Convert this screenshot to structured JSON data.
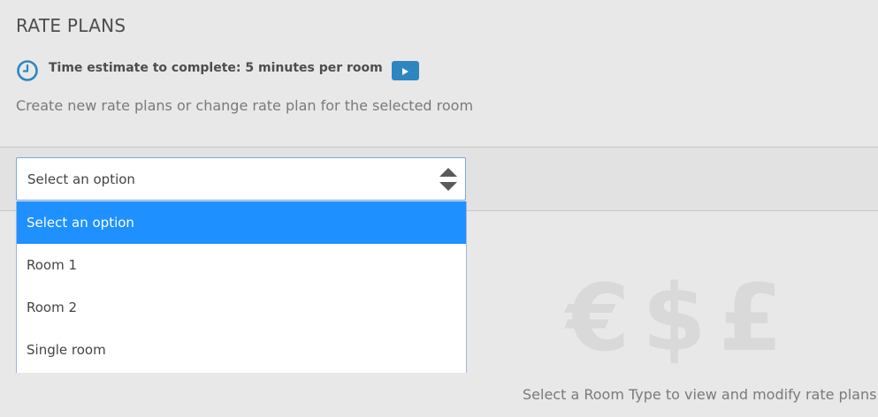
{
  "header": {
    "title": "RATE PLANS",
    "time_estimate": "Time estimate to complete: 5 minutes per room",
    "subtitle": "Create new rate plans or change rate plan for the selected room",
    "icons": {
      "clock": "clock-icon",
      "play": "play-icon"
    },
    "colors": {
      "clock": "#2e86c1",
      "play_button": "#2e86c1"
    }
  },
  "room_select": {
    "value": "Select an option",
    "options": [
      {
        "label": "Select an option",
        "selected": true
      },
      {
        "label": "Room 1",
        "selected": false
      },
      {
        "label": "Room 2",
        "selected": false
      },
      {
        "label": "Single room",
        "selected": false
      }
    ],
    "highlight_color": "#1e90ff"
  },
  "empty_state": {
    "currency_symbols": "€$£",
    "message": "Select a Room Type to view and modify rate plans"
  }
}
